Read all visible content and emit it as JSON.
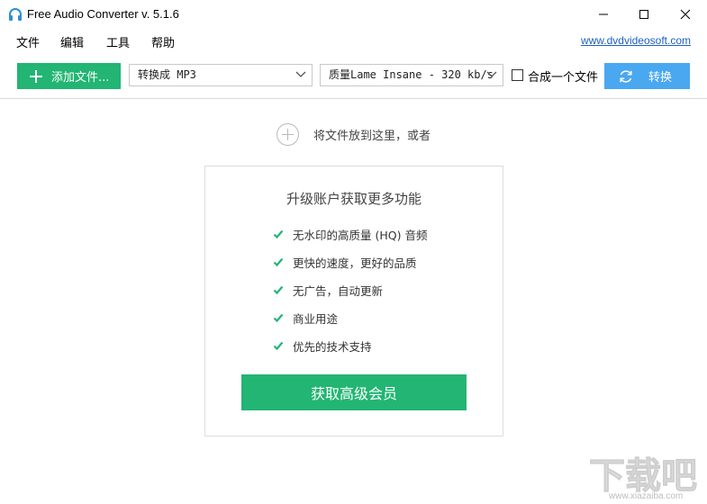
{
  "window": {
    "title": "Free Audio Converter v. 5.1.6",
    "icon": "headphones-icon"
  },
  "menu": {
    "items": [
      "文件",
      "编辑",
      "工具",
      "帮助"
    ],
    "link": "www.dvdvideosoft.com"
  },
  "toolbar": {
    "add_label": "添加文件...",
    "format_value": "转换成 MP3",
    "quality_value": "质量Lame Insane - 320 kb/s",
    "merge_label": "合成一个文件",
    "merge_checked": false,
    "convert_label": "转换"
  },
  "drop": {
    "text": "将文件放到这里，或者"
  },
  "upgrade": {
    "title": "升级账户获取更多功能",
    "features": [
      "无水印的高质量 (HQ) 音频",
      "更快的速度，更好的品质",
      "无广告，自动更新",
      "商业用途",
      "优先的技术支持"
    ],
    "button_label": "获取高级会员"
  },
  "watermark": {
    "logo_text": "下载吧",
    "url": "www.xiazaiba.com"
  },
  "colors": {
    "green": "#22b573",
    "blue": "#4aa8f0",
    "link": "#1f5fbf"
  }
}
